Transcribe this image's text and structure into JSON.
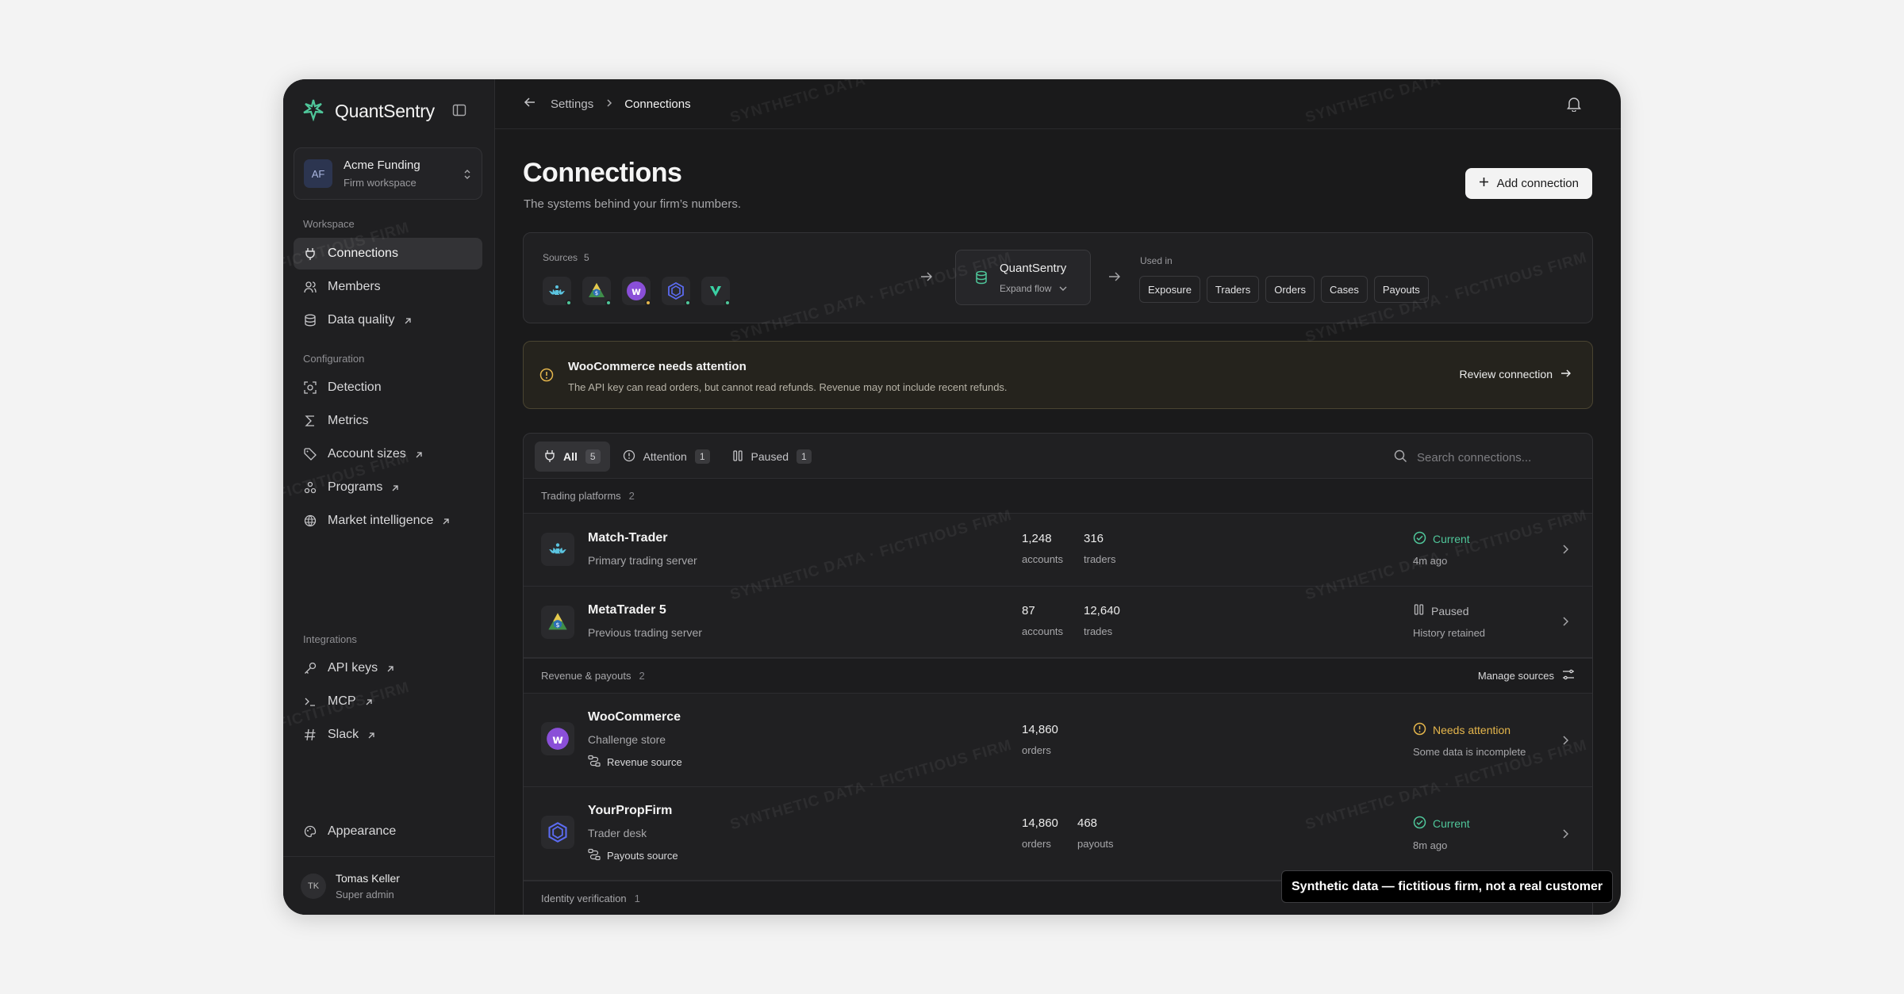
{
  "brand": {
    "name": "QuantSentry"
  },
  "workspace": {
    "initials": "AF",
    "name": "Acme Funding",
    "subtitle": "Firm workspace"
  },
  "sidebar": {
    "sections": [
      {
        "label": "Workspace",
        "items": [
          {
            "label": "Connections",
            "icon": "plug-icon",
            "active": true,
            "external": false
          },
          {
            "label": "Members",
            "icon": "users-icon",
            "external": false
          },
          {
            "label": "Data quality",
            "icon": "database-icon",
            "external": true
          }
        ]
      },
      {
        "label": "Configuration",
        "items": [
          {
            "label": "Detection",
            "icon": "scan-icon",
            "external": false
          },
          {
            "label": "Metrics",
            "icon": "sigma-icon",
            "external": false
          },
          {
            "label": "Account sizes",
            "icon": "tag-icon",
            "external": true
          },
          {
            "label": "Programs",
            "icon": "programs-icon",
            "external": true
          },
          {
            "label": "Market intelligence",
            "icon": "globe-icon",
            "external": true
          }
        ]
      },
      {
        "label": "Integrations",
        "items": [
          {
            "label": "API keys",
            "icon": "key-icon",
            "external": true
          },
          {
            "label": "MCP",
            "icon": "terminal-icon",
            "external": true
          },
          {
            "label": "Slack",
            "icon": "hash-icon",
            "external": true
          }
        ]
      }
    ],
    "appearance": "Appearance"
  },
  "user": {
    "initials": "TK",
    "name": "Tomas Keller",
    "role": "Super admin"
  },
  "breadcrumb": {
    "parent": "Settings",
    "current": "Connections"
  },
  "page": {
    "title": "Connections",
    "subtitle": "The systems behind your firm’s numbers.",
    "add_label": "Add connection"
  },
  "flow": {
    "sources_label": "Sources",
    "sources_count": "5",
    "hub_name": "QuantSentry",
    "hub_action": "Expand flow",
    "used_label": "Used in",
    "used_in": [
      "Exposure",
      "Traders",
      "Orders",
      "Cases",
      "Payouts"
    ]
  },
  "alert": {
    "title": "WooCommerce needs attention",
    "description": "The API key can read orders, but cannot read refunds. Revenue may not include recent refunds.",
    "action": "Review connection"
  },
  "filters": {
    "tabs": [
      {
        "label": "All",
        "count": "5",
        "active": true
      },
      {
        "label": "Attention",
        "count": "1"
      },
      {
        "label": "Paused",
        "count": "1"
      }
    ],
    "search_placeholder": "Search connections..."
  },
  "groups": [
    {
      "label": "Trading platforms",
      "count": "2",
      "action": ""
    },
    {
      "label": "Revenue & payouts",
      "count": "2",
      "action": "Manage sources"
    },
    {
      "label": "Identity verification",
      "count": "1",
      "action": ""
    }
  ],
  "rows": [
    {
      "name": "Match-Trader",
      "desc": "Primary trading server",
      "tag": "",
      "stats": [
        {
          "value": "1,248",
          "label": "accounts"
        },
        {
          "value": "316",
          "label": "traders"
        }
      ],
      "status": "Current",
      "status_sub": "4m ago",
      "status_color": "#4fc69a"
    },
    {
      "name": "MetaTrader 5",
      "desc": "Previous trading server",
      "tag": "",
      "stats": [
        {
          "value": "87",
          "label": "accounts"
        },
        {
          "value": "12,640",
          "label": "trades"
        }
      ],
      "status": "Paused",
      "status_sub": "History retained",
      "status_color": "#b8b8bb"
    },
    {
      "name": "WooCommerce",
      "desc": "Challenge store",
      "tag": "Revenue source",
      "stats": [
        {
          "value": "14,860",
          "label": "orders"
        }
      ],
      "status": "Needs attention",
      "status_sub": "Some data is incomplete",
      "status_color": "#e5b64c"
    },
    {
      "name": "YourPropFirm",
      "desc": "Trader desk",
      "tag": "Payouts source",
      "stats": [
        {
          "value": "14,860",
          "label": "orders"
        },
        {
          "value": "468",
          "label": "payouts"
        }
      ],
      "status": "Current",
      "status_sub": "8m ago",
      "status_color": "#4fc69a"
    }
  ],
  "toast": "Synthetic data — fictitious firm, not a real customer",
  "watermarks": {
    "primary": "SYNTHETIC DATA · FICTITIOUS FIRM",
    "secondary": "FICTITIOUS FIRM"
  },
  "colors": {
    "accent": "#4fc69a",
    "warning": "#e5b64c",
    "woocommerce": "#7f54b3"
  }
}
